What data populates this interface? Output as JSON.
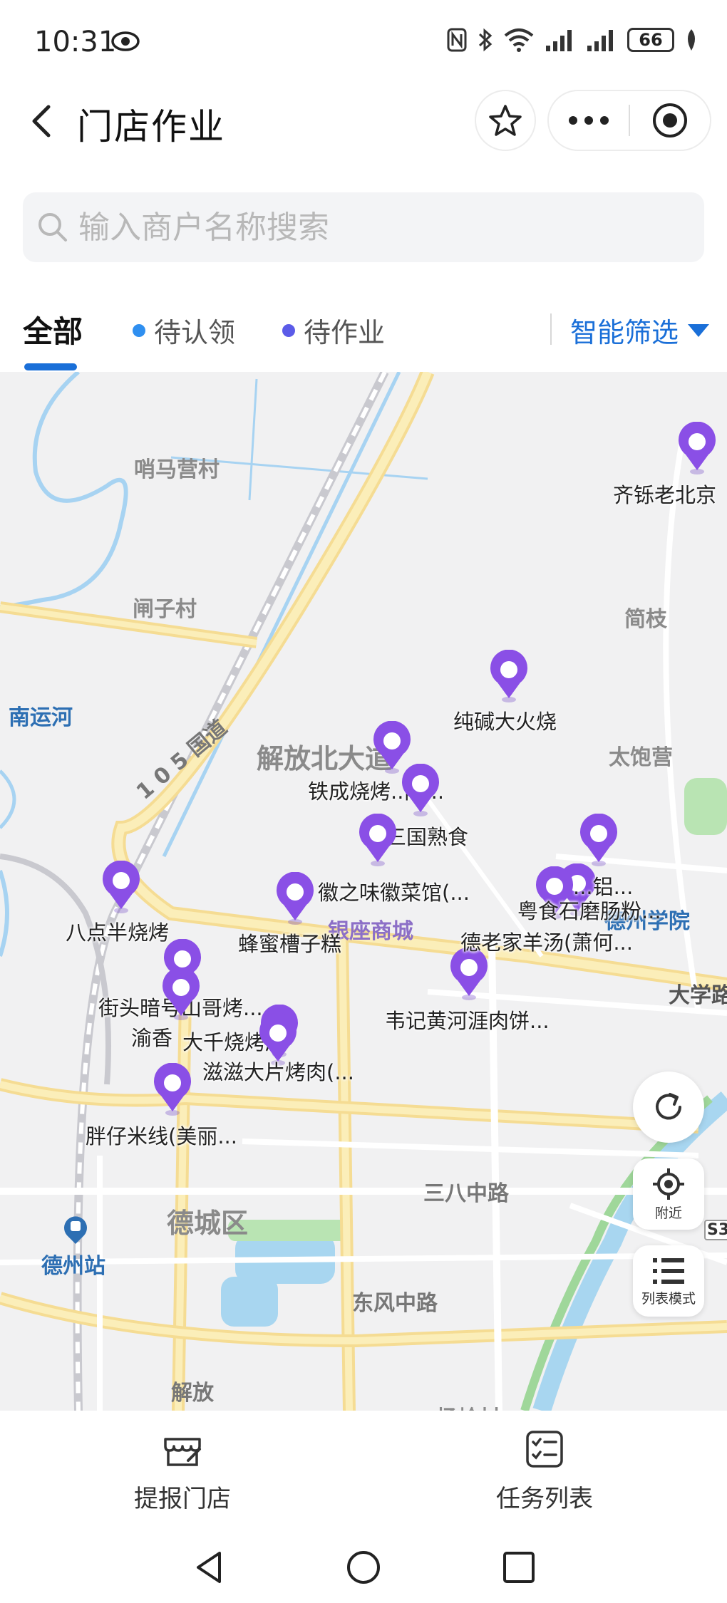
{
  "status_bar": {
    "time": "10:31",
    "battery": "66",
    "icons": [
      "eye-icon",
      "nfc-icon",
      "bluetooth-icon",
      "wifi-icon",
      "signal-icon",
      "signal-icon",
      "battery-icon",
      "leaf-icon"
    ]
  },
  "header": {
    "title": "门店作业"
  },
  "search": {
    "placeholder": "输入商户名称搜索"
  },
  "tabs": [
    {
      "label": "全部",
      "active": true
    },
    {
      "label": "待认领",
      "dot_color": "#2f8ff0"
    },
    {
      "label": "待作业",
      "dot_color": "#5b5be8"
    }
  ],
  "filter": {
    "label": "智能筛选",
    "color": "#1a6fd8"
  },
  "map": {
    "places": [
      {
        "name": "哨马营村"
      },
      {
        "name": "闸子村"
      },
      {
        "name": "简枝"
      },
      {
        "name": "南运河"
      },
      {
        "name": "1 0 5 国道"
      },
      {
        "name": "解放北大道"
      },
      {
        "name": "太饱营"
      },
      {
        "name": "银座商城"
      },
      {
        "name": "德州学院"
      },
      {
        "name": "大学路"
      },
      {
        "name": "三八中路"
      },
      {
        "name": "德城区"
      },
      {
        "name": "德州站"
      },
      {
        "name": "东风中路"
      },
      {
        "name": "解放"
      },
      {
        "name": "S3"
      },
      {
        "name": "杨岭村"
      }
    ],
    "stores": [
      {
        "label": "齐铄老北京"
      },
      {
        "label": "纯碱大火烧"
      },
      {
        "label": "铁成烧烤..南..."
      },
      {
        "label": "卤三国熟食"
      },
      {
        "label": "徽之味徽菜馆(..."
      },
      {
        "label": "八点半烧烤"
      },
      {
        "label": "蜂蜜槽子糕"
      },
      {
        "label": "街头暗号山哥烤..."
      },
      {
        "label": "渝香"
      },
      {
        "label": "大千烧烤店"
      },
      {
        "label": "滋滋大片烤肉(..."
      },
      {
        "label": "胖仔米线(美丽..."
      },
      {
        "label": "韦记黄河涯肉饼..."
      },
      {
        "label": "德老家羊汤(萧何..."
      },
      {
        "label": "粤食石磨肠粉..."
      },
      {
        "label": "...铝..."
      }
    ],
    "pin_color": "#8a4fe6",
    "buttons": {
      "nearby": "附近",
      "list_mode": "列表模式"
    }
  },
  "bottom_nav": {
    "report_store": "提报门店",
    "task_list": "任务列表"
  }
}
